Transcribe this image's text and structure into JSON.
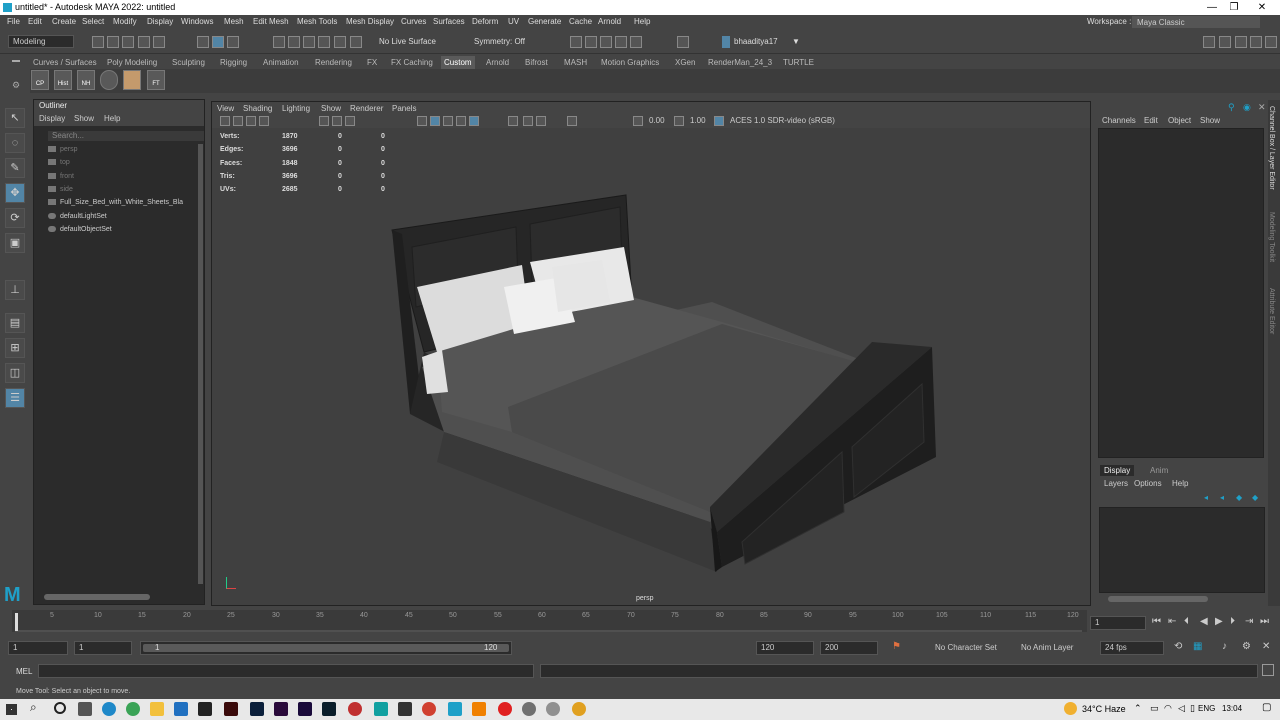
{
  "titlebar": {
    "title": "untitled* - Autodesk MAYA 2022: untitled",
    "min": "—",
    "max": "❐",
    "close": "✕"
  },
  "menus": [
    "File",
    "Edit",
    "Create",
    "Select",
    "Modify",
    "Display",
    "Windows",
    "Mesh",
    "Edit Mesh",
    "Mesh Tools",
    "Mesh Display",
    "Curves",
    "Surfaces",
    "Deform",
    "UV",
    "Generate",
    "Cache",
    "Arnold",
    "Help"
  ],
  "workspace": {
    "label": "Workspace :",
    "value": "Maya Classic"
  },
  "statusline": {
    "menuset": "Modeling",
    "live_surface": "No Live Surface",
    "symmetry": "Symmetry: Off",
    "user": "bhaaditya17"
  },
  "shelf": {
    "tabs": [
      "Curves / Surfaces",
      "Poly Modeling",
      "Sculpting",
      "Rigging",
      "Animation",
      "Rendering",
      "FX",
      "FX Caching",
      "Custom",
      "Arnold",
      "Bifrost",
      "MASH",
      "Motion Graphics",
      "XGen",
      "RenderMan_24_3",
      "TURTLE"
    ],
    "active": "Custom",
    "icons": [
      "CP",
      "Hist",
      "NH",
      "",
      "",
      "FT"
    ]
  },
  "outliner": {
    "title": "Outliner",
    "menu": [
      "Display",
      "Show",
      "Help"
    ],
    "search_placeholder": "Search...",
    "items": [
      {
        "label": "persp",
        "dim": true
      },
      {
        "label": "top",
        "dim": true
      },
      {
        "label": "front",
        "dim": true
      },
      {
        "label": "side",
        "dim": true
      },
      {
        "label": "Full_Size_Bed_with_White_Sheets_Bla",
        "dim": false
      },
      {
        "label": "defaultLightSet",
        "dim": false
      },
      {
        "label": "defaultObjectSet",
        "dim": false
      }
    ]
  },
  "viewport": {
    "menu": [
      "View",
      "Shading",
      "Lighting",
      "Show",
      "Renderer",
      "Panels"
    ],
    "exposure": "0.00",
    "gamma": "1.00",
    "colorspace": "ACES 1.0 SDR-video (sRGB)",
    "camera_label": "persp",
    "hud": [
      {
        "label": "Verts:",
        "a": "1870",
        "b": "0",
        "c": "0"
      },
      {
        "label": "Edges:",
        "a": "3696",
        "b": "0",
        "c": "0"
      },
      {
        "label": "Faces:",
        "a": "1848",
        "b": "0",
        "c": "0"
      },
      {
        "label": "Tris:",
        "a": "3696",
        "b": "0",
        "c": "0"
      },
      {
        "label": "UVs:",
        "a": "2685",
        "b": "0",
        "c": "0"
      }
    ]
  },
  "channelbox": {
    "menu": [
      "Channels",
      "Edit",
      "Object",
      "Show"
    ],
    "layer_tabs": [
      "Display",
      "Anim"
    ],
    "layer_menu": [
      "Layers",
      "Options",
      "Help"
    ]
  },
  "rightstrip": [
    "Channel Box / Layer Editor",
    "Modeling Toolkit",
    "Attribute Editor"
  ],
  "timeline": {
    "ticks": [
      "5",
      "10",
      "15",
      "20",
      "25",
      "30",
      "35",
      "40",
      "45",
      "50",
      "55",
      "60",
      "65",
      "70",
      "75",
      "80",
      "85",
      "90",
      "95",
      "100",
      "105",
      "110",
      "115",
      "120"
    ],
    "current_frame": "1"
  },
  "range": {
    "start": "1",
    "start2": "1",
    "slider_start": "1",
    "slider_end": "120",
    "end": "120",
    "end2": "200",
    "character_set": "No Character Set",
    "anim_layer": "No Anim Layer",
    "fps": "24 fps"
  },
  "cmd": {
    "label": "MEL"
  },
  "helpline": "Move Tool: Select an object to move.",
  "taskbar": {
    "weather": "34°C  Haze",
    "lang": "ENG",
    "time": "13:04"
  },
  "colors": {
    "accent": "#5285a6",
    "maya_blue": "#1fa0c8"
  }
}
